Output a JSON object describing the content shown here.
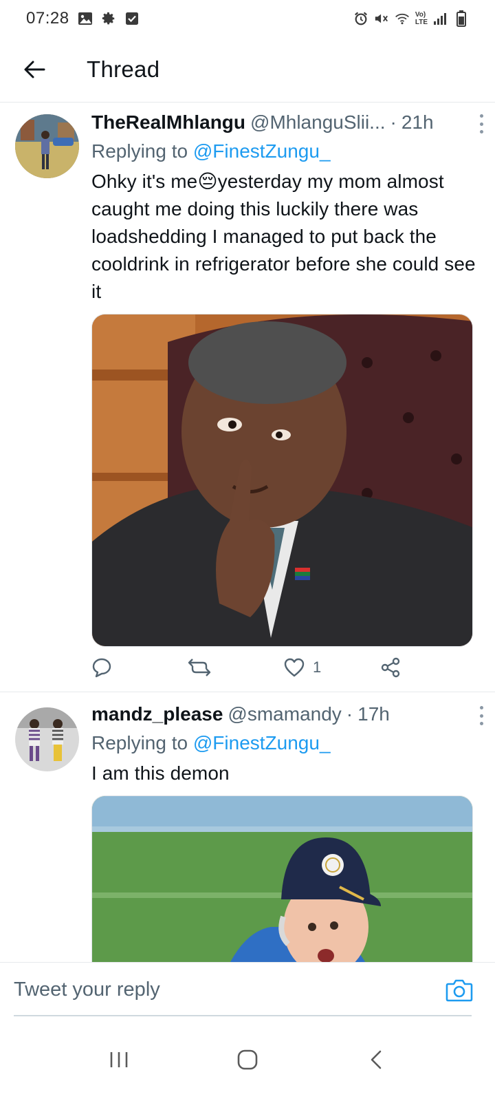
{
  "status_bar": {
    "time": "07:28",
    "left_icons": [
      "image-icon",
      "gear-icon",
      "check-box-icon"
    ],
    "right_icons": [
      "alarm-icon",
      "mute-icon",
      "wifi-icon",
      "volte-icon",
      "signal-icon",
      "battery-icon"
    ],
    "volte_label_top": "Vo)",
    "volte_label_bottom": "LTE"
  },
  "header": {
    "back_icon": "arrow-left-icon",
    "title": "Thread"
  },
  "tweets": [
    {
      "display_name": "TheRealMhlangu",
      "handle": "@MhlanguSlii...",
      "separator": "·",
      "time": "21h",
      "replying_prefix": "Replying to",
      "replying_to": "@FinestZungu_",
      "text_before_emoji": "Ohky it's me",
      "emoji": "😔",
      "text_after_emoji": "yesterday my mom almost caught me doing this luckily there was loadshedding I managed to put back the cooldrink in refrigerator before she could see it",
      "actions": {
        "reply_icon": "comment-icon",
        "retweet_icon": "retweet-icon",
        "like_icon": "heart-icon",
        "like_count": "1",
        "share_icon": "share-icon"
      }
    },
    {
      "display_name": "mandz_please",
      "handle": "@smamandy",
      "separator": "·",
      "time": "17h",
      "replying_prefix": "Replying to",
      "replying_to": "@FinestZungu_",
      "text": "I am this demon"
    }
  ],
  "composer": {
    "placeholder": "Tweet your reply",
    "camera_icon": "camera-icon"
  },
  "nav_bar": {
    "icons": [
      "recent-apps-icon",
      "home-icon",
      "back-icon"
    ]
  },
  "colors": {
    "accent": "#1d9bf0",
    "text_primary": "#0f1419",
    "text_secondary": "#536471",
    "divider": "#e6e9ec"
  }
}
